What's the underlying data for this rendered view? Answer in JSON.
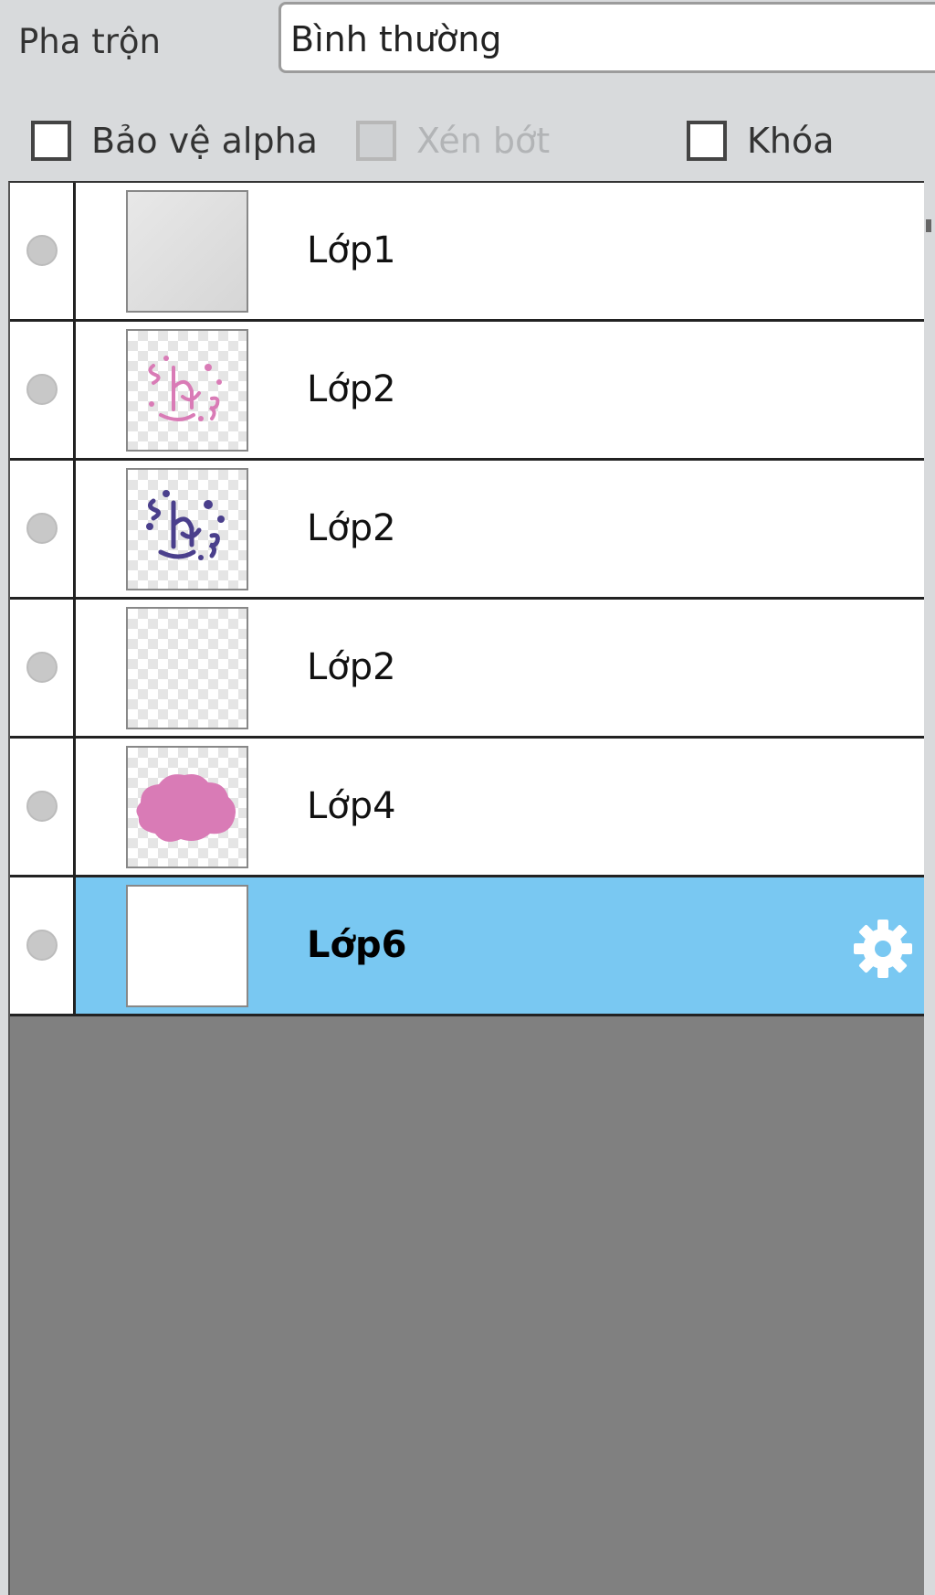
{
  "blend": {
    "label": "Pha trộn",
    "value": "Bình thường"
  },
  "options": {
    "protect_alpha": {
      "label": "Bảo vệ alpha",
      "checked": false,
      "enabled": true
    },
    "clip": {
      "label": "Xén bớt",
      "checked": false,
      "enabled": false
    },
    "lock": {
      "label": "Khóa",
      "checked": false,
      "enabled": true
    }
  },
  "layers": [
    {
      "name": "Lớp1",
      "thumbnail": "gray-fill",
      "selected": false
    },
    {
      "name": "Lớp2",
      "thumbnail": "pink-lettering",
      "selected": false
    },
    {
      "name": "Lớp2",
      "thumbnail": "purple-lettering",
      "selected": false
    },
    {
      "name": "Lớp2",
      "thumbnail": "empty-transparent",
      "selected": false
    },
    {
      "name": "Lớp4",
      "thumbnail": "pink-blob",
      "selected": false
    },
    {
      "name": "Lớp6",
      "thumbnail": "white-fill",
      "selected": true,
      "icon": "gear-icon"
    }
  ],
  "colors": {
    "selected_row": "#79c8f2",
    "panel_background": "#808080",
    "pink": "#d97bb6",
    "purple": "#4a3f8c"
  }
}
